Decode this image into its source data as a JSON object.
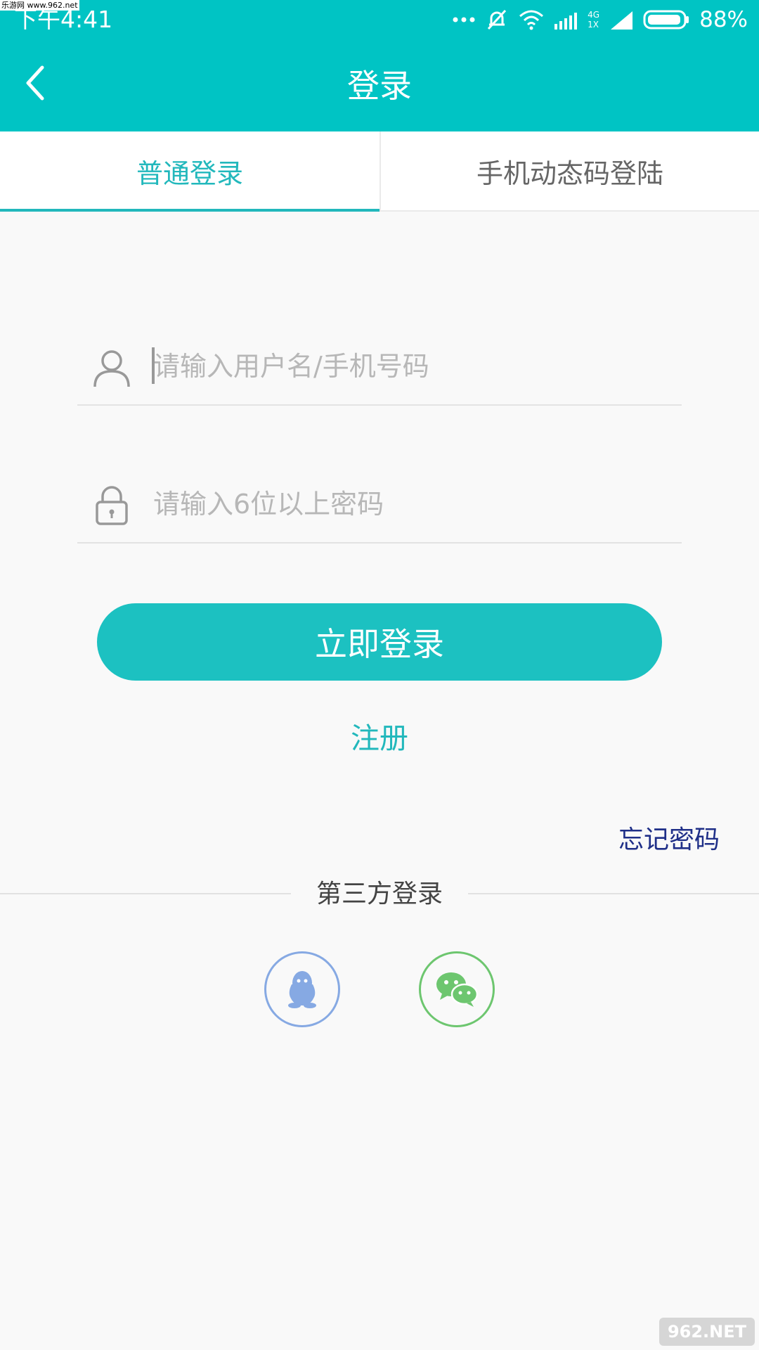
{
  "status_bar": {
    "time": "下午4:41",
    "network_4g": "4G",
    "network_1x": "1X",
    "battery": "88%"
  },
  "watermark": {
    "top_left": "乐游网 www.962.net",
    "bottom_right": "962.NET"
  },
  "header": {
    "title": "登录"
  },
  "tabs": [
    {
      "label": "普通登录",
      "active": true
    },
    {
      "label": "手机动态码登陆",
      "active": false
    }
  ],
  "form": {
    "username_placeholder": "请输入用户名/手机号码",
    "password_placeholder": "请输入6位以上密码",
    "login_label": "立即登录",
    "register_label": "注册",
    "forgot_label": "忘记密码"
  },
  "third_party": {
    "title": "第三方登录"
  },
  "colors": {
    "accent": "#00c4c4",
    "qq": "#86a9e3",
    "wechat": "#6dc66f",
    "forgot": "#1f2f88"
  }
}
